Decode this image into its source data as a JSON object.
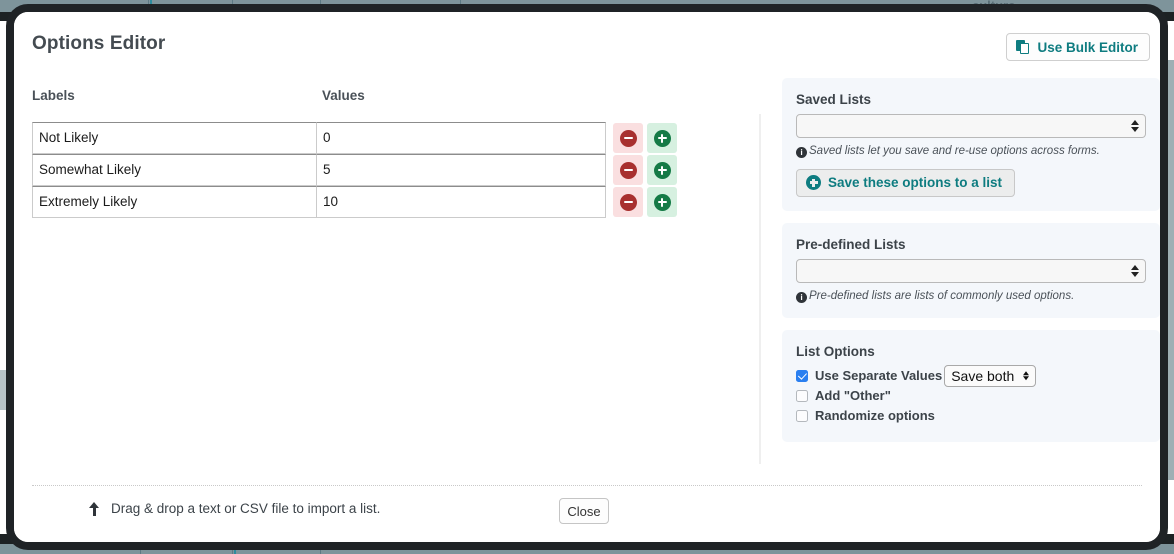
{
  "modal": {
    "title": "Options Editor",
    "bulk_editor_button": "Use Bulk Editor",
    "columns": {
      "labels": "Labels",
      "values": "Values"
    },
    "rows": [
      {
        "label": "Not Likely",
        "value": "0"
      },
      {
        "label": "Somewhat Likely",
        "value": "5"
      },
      {
        "label": "Extremely Likely",
        "value": "10"
      }
    ],
    "row_buttons": {
      "remove_title": "Remove option",
      "add_title": "Add option"
    },
    "footer": {
      "drag_hint": "Drag & drop a text or CSV file to import a list.",
      "close_button": "Close"
    }
  },
  "sidebar": {
    "saved_lists": {
      "title": "Saved Lists",
      "select_value": "",
      "help": "Saved lists let you save and re-use options across forms.",
      "save_button": "Save these options to a list"
    },
    "predefined_lists": {
      "title": "Pre-defined Lists",
      "select_value": "",
      "help": "Pre-defined lists are lists of commonly used options."
    },
    "list_options": {
      "title": "List Options",
      "items": [
        {
          "label": "Use Separate Values",
          "checked": true
        },
        {
          "label": "Add \"Other\"",
          "checked": false
        },
        {
          "label": "Randomize options",
          "checked": false
        }
      ],
      "separate_values_select": "Save both"
    }
  },
  "colors": {
    "teal": "#0e7c80",
    "checkbox_blue": "#2a7ff0",
    "remove_red": "#a8302f",
    "add_green": "#157a46",
    "panel_bg": "#f4f7fb",
    "modal_border": "#1f2326"
  },
  "backdrop": {
    "partial_text": "culture."
  }
}
